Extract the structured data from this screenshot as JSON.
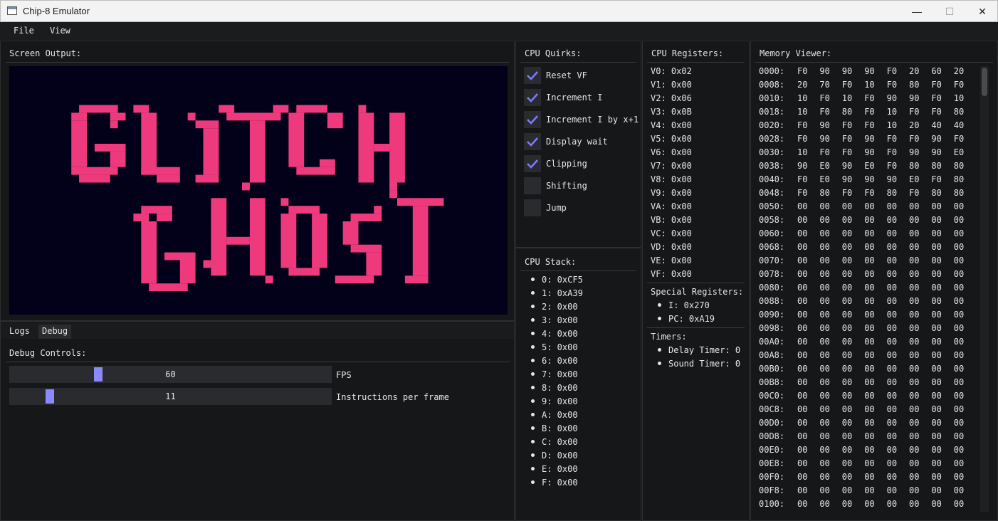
{
  "window": {
    "title": "Chip-8 Emulator",
    "minimize": "—",
    "maximize": "☐",
    "close": "✕"
  },
  "menu": [
    "File",
    "View"
  ],
  "screen": {
    "title": "Screen Output:",
    "pixel_color": "#ee3a7c",
    "background": "#03001a"
  },
  "tabs": [
    "Logs",
    "Debug"
  ],
  "debug": {
    "title": "Debug Controls:",
    "sliders": [
      {
        "label": "FPS",
        "value": "60",
        "fraction": 0.27
      },
      {
        "label": "Instructions per frame",
        "value": "11",
        "fraction": 0.115
      }
    ]
  },
  "quirks": {
    "title": "CPU Quirks:",
    "items": [
      {
        "label": "Reset VF",
        "checked": true
      },
      {
        "label": "Increment I",
        "checked": true
      },
      {
        "label": "Increment I by x+1",
        "checked": true
      },
      {
        "label": "Display wait",
        "checked": true
      },
      {
        "label": "Clipping",
        "checked": true
      },
      {
        "label": "Shifting",
        "checked": false
      },
      {
        "label": "Jump",
        "checked": false
      }
    ]
  },
  "stack": {
    "title": "CPU Stack:",
    "items": [
      "0: 0xCF5",
      "1: 0xA39",
      "2: 0x00",
      "3: 0x00",
      "4: 0x00",
      "5: 0x00",
      "6: 0x00",
      "7: 0x00",
      "8: 0x00",
      "9: 0x00",
      "A: 0x00",
      "B: 0x00",
      "C: 0x00",
      "D: 0x00",
      "E: 0x00",
      "F: 0x00"
    ]
  },
  "registers": {
    "title": "CPU Registers:",
    "items": [
      "V0: 0x02",
      "V1: 0x00",
      "V2: 0x06",
      "V3: 0x0B",
      "V4: 0x00",
      "V5: 0x00",
      "V6: 0x00",
      "V7: 0x00",
      "V8: 0x00",
      "V9: 0x00",
      "VA: 0x00",
      "VB: 0x00",
      "VC: 0x00",
      "VD: 0x00",
      "VE: 0x00",
      "VF: 0x00"
    ],
    "special_title": "Special Registers:",
    "special": [
      "I: 0x270",
      "PC: 0xA19"
    ],
    "timers_title": "Timers:",
    "timers": [
      "Delay Timer: 0",
      "Sound Timer: 0"
    ]
  },
  "memory": {
    "title": "Memory Viewer:",
    "rows": [
      {
        "addr": "0000:",
        "bytes": [
          "F0",
          "90",
          "90",
          "90",
          "F0",
          "20",
          "60",
          "20"
        ]
      },
      {
        "addr": "0008:",
        "bytes": [
          "20",
          "70",
          "F0",
          "10",
          "F0",
          "80",
          "F0",
          "F0"
        ]
      },
      {
        "addr": "0010:",
        "bytes": [
          "10",
          "F0",
          "10",
          "F0",
          "90",
          "90",
          "F0",
          "10"
        ]
      },
      {
        "addr": "0018:",
        "bytes": [
          "10",
          "F0",
          "80",
          "F0",
          "10",
          "F0",
          "F0",
          "80"
        ]
      },
      {
        "addr": "0020:",
        "bytes": [
          "F0",
          "90",
          "F0",
          "F0",
          "10",
          "20",
          "40",
          "40"
        ]
      },
      {
        "addr": "0028:",
        "bytes": [
          "F0",
          "90",
          "F0",
          "90",
          "F0",
          "F0",
          "90",
          "F0"
        ]
      },
      {
        "addr": "0030:",
        "bytes": [
          "10",
          "F0",
          "F0",
          "90",
          "F0",
          "90",
          "90",
          "E0"
        ]
      },
      {
        "addr": "0038:",
        "bytes": [
          "90",
          "E0",
          "90",
          "E0",
          "F0",
          "80",
          "80",
          "80"
        ]
      },
      {
        "addr": "0040:",
        "bytes": [
          "F0",
          "E0",
          "90",
          "90",
          "90",
          "E0",
          "F0",
          "80"
        ]
      },
      {
        "addr": "0048:",
        "bytes": [
          "F0",
          "80",
          "F0",
          "F0",
          "80",
          "F0",
          "80",
          "80"
        ]
      },
      {
        "addr": "0050:",
        "bytes": [
          "00",
          "00",
          "00",
          "00",
          "00",
          "00",
          "00",
          "00"
        ]
      },
      {
        "addr": "0058:",
        "bytes": [
          "00",
          "00",
          "00",
          "00",
          "00",
          "00",
          "00",
          "00"
        ]
      },
      {
        "addr": "0060:",
        "bytes": [
          "00",
          "00",
          "00",
          "00",
          "00",
          "00",
          "00",
          "00"
        ]
      },
      {
        "addr": "0068:",
        "bytes": [
          "00",
          "00",
          "00",
          "00",
          "00",
          "00",
          "00",
          "00"
        ]
      },
      {
        "addr": "0070:",
        "bytes": [
          "00",
          "00",
          "00",
          "00",
          "00",
          "00",
          "00",
          "00"
        ]
      },
      {
        "addr": "0078:",
        "bytes": [
          "00",
          "00",
          "00",
          "00",
          "00",
          "00",
          "00",
          "00"
        ]
      },
      {
        "addr": "0080:",
        "bytes": [
          "00",
          "00",
          "00",
          "00",
          "00",
          "00",
          "00",
          "00"
        ]
      },
      {
        "addr": "0088:",
        "bytes": [
          "00",
          "00",
          "00",
          "00",
          "00",
          "00",
          "00",
          "00"
        ]
      },
      {
        "addr": "0090:",
        "bytes": [
          "00",
          "00",
          "00",
          "00",
          "00",
          "00",
          "00",
          "00"
        ]
      },
      {
        "addr": "0098:",
        "bytes": [
          "00",
          "00",
          "00",
          "00",
          "00",
          "00",
          "00",
          "00"
        ]
      },
      {
        "addr": "00A0:",
        "bytes": [
          "00",
          "00",
          "00",
          "00",
          "00",
          "00",
          "00",
          "00"
        ]
      },
      {
        "addr": "00A8:",
        "bytes": [
          "00",
          "00",
          "00",
          "00",
          "00",
          "00",
          "00",
          "00"
        ]
      },
      {
        "addr": "00B0:",
        "bytes": [
          "00",
          "00",
          "00",
          "00",
          "00",
          "00",
          "00",
          "00"
        ]
      },
      {
        "addr": "00B8:",
        "bytes": [
          "00",
          "00",
          "00",
          "00",
          "00",
          "00",
          "00",
          "00"
        ]
      },
      {
        "addr": "00C0:",
        "bytes": [
          "00",
          "00",
          "00",
          "00",
          "00",
          "00",
          "00",
          "00"
        ]
      },
      {
        "addr": "00C8:",
        "bytes": [
          "00",
          "00",
          "00",
          "00",
          "00",
          "00",
          "00",
          "00"
        ]
      },
      {
        "addr": "00D0:",
        "bytes": [
          "00",
          "00",
          "00",
          "00",
          "00",
          "00",
          "00",
          "00"
        ]
      },
      {
        "addr": "00D8:",
        "bytes": [
          "00",
          "00",
          "00",
          "00",
          "00",
          "00",
          "00",
          "00"
        ]
      },
      {
        "addr": "00E0:",
        "bytes": [
          "00",
          "00",
          "00",
          "00",
          "00",
          "00",
          "00",
          "00"
        ]
      },
      {
        "addr": "00E8:",
        "bytes": [
          "00",
          "00",
          "00",
          "00",
          "00",
          "00",
          "00",
          "00"
        ]
      },
      {
        "addr": "00F0:",
        "bytes": [
          "00",
          "00",
          "00",
          "00",
          "00",
          "00",
          "00",
          "00"
        ]
      },
      {
        "addr": "00F8:",
        "bytes": [
          "00",
          "00",
          "00",
          "00",
          "00",
          "00",
          "00",
          "00"
        ]
      },
      {
        "addr": "0100:",
        "bytes": [
          "00",
          "00",
          "00",
          "00",
          "00",
          "00",
          "00",
          "00"
        ]
      }
    ]
  },
  "colors": {
    "accent": "#8a8aff",
    "check": "#7a7aff"
  }
}
